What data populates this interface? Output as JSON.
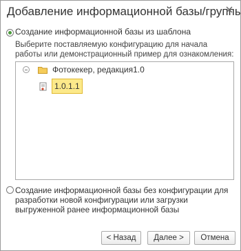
{
  "dialog": {
    "title": "Добавление информационной базы/группы"
  },
  "option_template": {
    "label": "Создание информационной базы из шаблона",
    "selected": true,
    "description": "Выберите поставляемую конфигурацию для начала работы или демонстрационный пример для ознакомления:"
  },
  "tree": {
    "folder": "Фотокекер, редакция1.0",
    "selected_item": "1.0.1.1"
  },
  "option_empty": {
    "label": "Создание информационной базы без конфигурации для разработки новой конфигурации или загрузки выгруженной ранее информационной базы",
    "selected": false
  },
  "buttons": {
    "back": "< Назад",
    "next": "Далее >",
    "cancel": "Отмена"
  },
  "colors": {
    "radio_selected": "#4a9a3a",
    "selection_fill": "#fce98a",
    "folder": "#f5cc5a"
  }
}
